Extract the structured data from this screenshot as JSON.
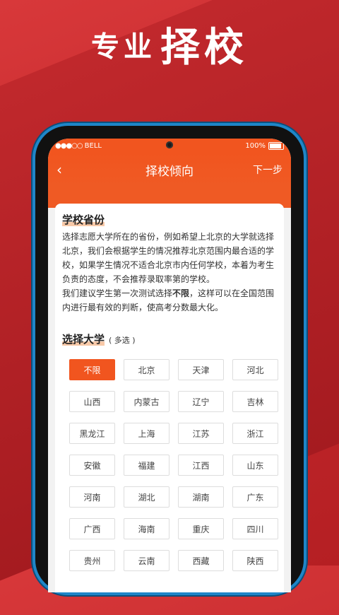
{
  "banner": {
    "title_small": "专业",
    "title_big": "择校"
  },
  "statusbar": {
    "carrier": "BELL",
    "battery": "100%"
  },
  "navbar": {
    "back_glyph": "‹",
    "title": "择校倾向",
    "next_label": "下一步"
  },
  "section_province": {
    "title": "学校省份",
    "para1": "选择志愿大学所在的省份，例如希望上北京的大学就选择北京，我们会根据学生的情况推荐北京范围内最合适的学校，如果学生情况不适合北京市内任何学校，本着为考生负责的态度，不会推荐录取率第的学校。",
    "para2_before": "我们建议学生第一次测试选择",
    "para2_bold": "不限",
    "para2_after": "，这样可以在全国范围内进行最有效的判断，使高考分数最大化。"
  },
  "section_select": {
    "title": "选择大学",
    "subtitle": "( 多选 )"
  },
  "provinces": [
    {
      "label": "不限",
      "selected": true
    },
    {
      "label": "北京",
      "selected": false
    },
    {
      "label": "天津",
      "selected": false
    },
    {
      "label": "河北",
      "selected": false
    },
    {
      "label": "山西",
      "selected": false
    },
    {
      "label": "内蒙古",
      "selected": false
    },
    {
      "label": "辽宁",
      "selected": false
    },
    {
      "label": "吉林",
      "selected": false
    },
    {
      "label": "黑龙江",
      "selected": false
    },
    {
      "label": "上海",
      "selected": false
    },
    {
      "label": "江苏",
      "selected": false
    },
    {
      "label": "浙江",
      "selected": false
    },
    {
      "label": "安徽",
      "selected": false
    },
    {
      "label": "福建",
      "selected": false
    },
    {
      "label": "江西",
      "selected": false
    },
    {
      "label": "山东",
      "selected": false
    },
    {
      "label": "河南",
      "selected": false
    },
    {
      "label": "湖北",
      "selected": false
    },
    {
      "label": "湖南",
      "selected": false
    },
    {
      "label": "广东",
      "selected": false
    },
    {
      "label": "广西",
      "selected": false
    },
    {
      "label": "海南",
      "selected": false
    },
    {
      "label": "重庆",
      "selected": false
    },
    {
      "label": "四川",
      "selected": false
    },
    {
      "label": "贵州",
      "selected": false
    },
    {
      "label": "云南",
      "selected": false
    },
    {
      "label": "西藏",
      "selected": false
    },
    {
      "label": "陕西",
      "selected": false
    }
  ],
  "colors": {
    "accent": "#f1551f",
    "background": "#c42a2d"
  }
}
